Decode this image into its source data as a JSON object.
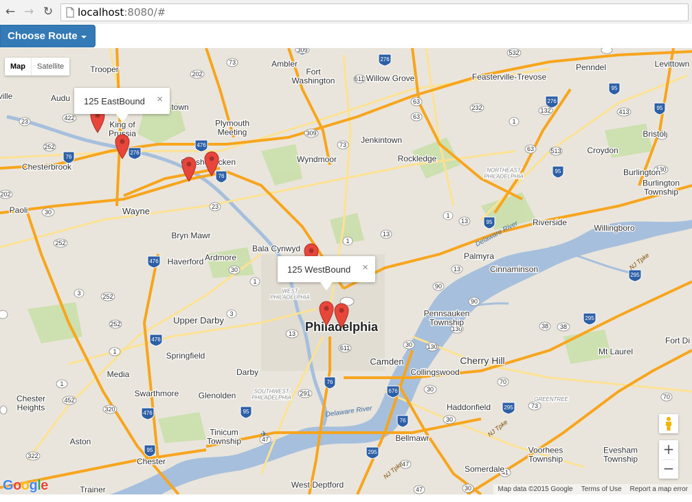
{
  "browser": {
    "url_host": "localhost",
    "url_rest": ":8080/#",
    "back_icon": "arrow-left",
    "forward_icon": "arrow-right",
    "reload_icon": "reload",
    "page_icon": "document"
  },
  "toolbar": {
    "choose_route_label": "Choose Route"
  },
  "map_type": {
    "map_label": "Map",
    "satellite_label": "Satellite"
  },
  "info_windows": [
    {
      "label": "125 EastBound",
      "close": "×"
    },
    {
      "label": "125 WestBound",
      "close": "×"
    }
  ],
  "place_labels": {
    "trooper": "Trooper",
    "ambler": "Ambler",
    "fort_washington": "Fort\nWashington",
    "willow_grove": "Willow Grove",
    "feasterville": "Feasterville-Trevose",
    "penndel": "Penndel",
    "levittown": "Levittown",
    "king_of_prussia": "King of\nPrussia",
    "plymouth_meeting": "Plymouth\nMeeting",
    "jenkintown": "Jenkintown",
    "bristol": "Bristol",
    "croydon": "Croydon",
    "chesterbrook": "Chesterbrook",
    "wyndmoor": "Wyndmoor",
    "rockledge": "Rockledge",
    "northeast_philadelphia": "NORTHEAST\nPHILADELPHIA",
    "burlington": "Burlington",
    "burlington_township": "Burlington\nTownship",
    "paoli": "Paoli",
    "wayne": "Wayne",
    "riverside": "Riverside",
    "willingboro": "Willingboro",
    "bryn_mawr": "Bryn Mawr",
    "bala_cynwyd": "Bala Cynwyd",
    "palmyra": "Palmyra",
    "cinnaminson": "Cinnaminson",
    "haverford": "Haverford",
    "ardmore": "Ardmore",
    "west_philadelphia": "WEST\nPHILADELPHIA",
    "upper_darby": "Upper Darby",
    "philadelphia": "Philadelphia",
    "pennsauken": "Pennsauken\nTownship",
    "fort_dix": "Fort Di",
    "springfield": "Springfield",
    "camden": "Camden",
    "cherry_hill": "Cherry Hill",
    "mt_laurel": "Mt Laurel",
    "media": "Media",
    "darby": "Darby",
    "collingswood": "Collingswood",
    "swarthmore": "Swarthmore",
    "glenolden": "Glenolden",
    "southwest_philadelphia": "SOUTHWEST\nPHILADELPHIA",
    "greentree": "GREENTREE",
    "chester_heights": "Chester\nHeights",
    "haddonfield": "Haddonfield",
    "tinicum": "Tinicum\nTownship",
    "aston": "Aston",
    "bellmawr": "Bellmawr",
    "voorhees": "Voorhees\nTownship",
    "evesham": "Evesham\nTownship",
    "chester": "Chester",
    "somerdale": "Somerdale",
    "trainer": "Trainer",
    "west_deptford": "West Deptford",
    "audubon": "Audu",
    "ville": "ville",
    "norristown": "town",
    "conshohocken": "Conshohocken",
    "delaware_river": "Delaware River",
    "nj_turnpike": "NJ Tpke"
  },
  "controls": {
    "zoom_in": "+",
    "zoom_out": "−",
    "pegman_icon": "pegman"
  },
  "attribution": {
    "logo": "Google",
    "map_data": "Map data ©2015 Google",
    "terms": "Terms of Use",
    "report": "Report a map error"
  },
  "colors": {
    "land": "#e9e5dc",
    "water": "#a5bfdd",
    "park": "#cadfaa",
    "highway": "#f7a51d",
    "arterial": "#fde293",
    "button": "#337ab7",
    "marker": "#e8463b"
  }
}
